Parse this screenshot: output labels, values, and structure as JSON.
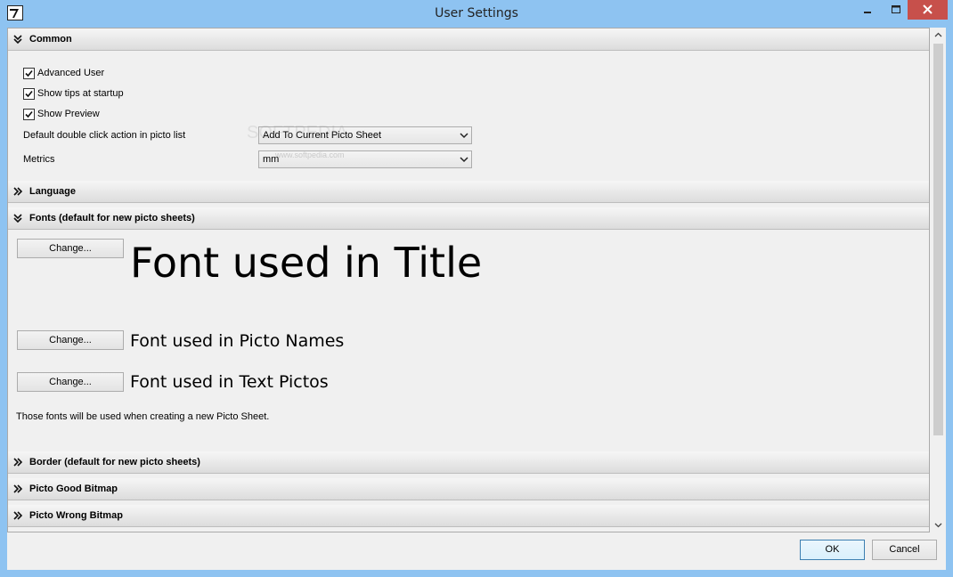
{
  "window": {
    "title": "User Settings",
    "icons": {
      "app": "app-icon",
      "minimize": "minimize-icon",
      "maximize": "maximize-icon",
      "close": "close-icon"
    },
    "colors": {
      "frame": "#8ec3f1",
      "close": "#c7504b",
      "panel": "#f0f0f0"
    }
  },
  "sections": {
    "common": {
      "label": "Common",
      "expanded": true
    },
    "language": {
      "label": "Language",
      "expanded": false
    },
    "fonts": {
      "label": "Fonts (default for new picto sheets)",
      "expanded": true
    },
    "border": {
      "label": "Border (default for new picto sheets)",
      "expanded": false
    },
    "good_bitmap": {
      "label": "Picto Good Bitmap",
      "expanded": false
    },
    "wrong_bitmap": {
      "label": "Picto Wrong Bitmap",
      "expanded": false
    }
  },
  "common": {
    "advanced_user": {
      "label": "Advanced User",
      "checked": true
    },
    "show_tips": {
      "label": "Show tips at startup",
      "checked": true
    },
    "show_preview": {
      "label": "Show Preview",
      "checked": true
    },
    "double_click_label": "Default double click action in picto list",
    "double_click_value": "Add To Current Picto Sheet",
    "metrics_label": "Metrics",
    "metrics_value": "mm"
  },
  "fonts": {
    "change_label": "Change...",
    "title_sample": "Font used in Title",
    "names_sample": "Font used in Picto Names",
    "text_sample": "Font used in Text Pictos",
    "note": "Those fonts will be used when creating a new Picto Sheet."
  },
  "watermark": {
    "main": "SOFTPEDIA",
    "sub": "www.softpedia.com"
  },
  "footer": {
    "ok": "OK",
    "cancel": "Cancel"
  }
}
